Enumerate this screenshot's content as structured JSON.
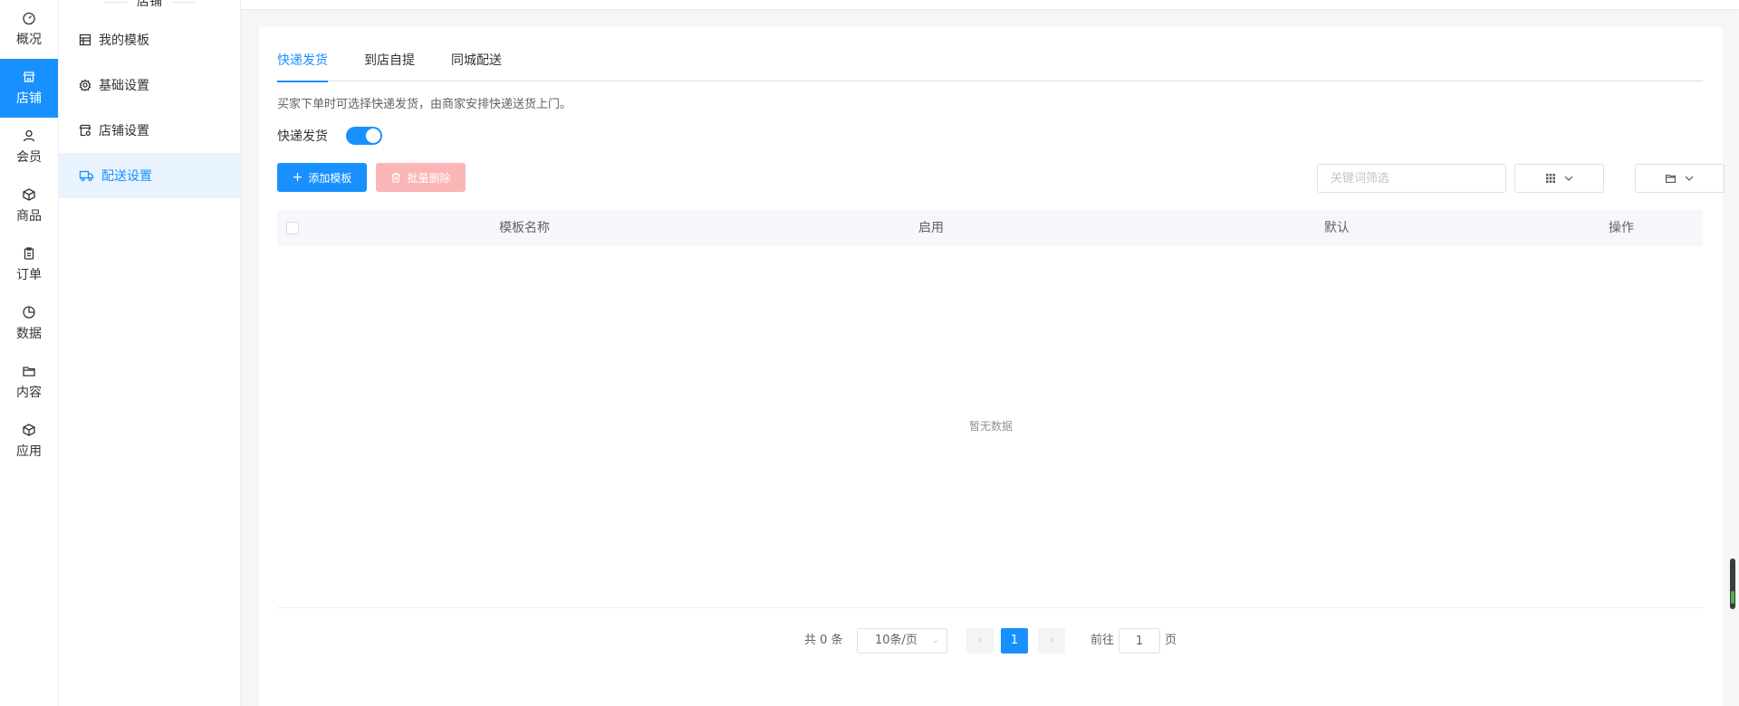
{
  "nav": {
    "items": [
      {
        "label": "概况",
        "icon": "dashboard-icon",
        "active": false
      },
      {
        "label": "店铺",
        "icon": "store-icon",
        "active": true
      },
      {
        "label": "会员",
        "icon": "user-icon",
        "active": false
      },
      {
        "label": "商品",
        "icon": "box-icon",
        "active": false
      },
      {
        "label": "订单",
        "icon": "clipboard-icon",
        "active": false
      },
      {
        "label": "数据",
        "icon": "pie-chart-icon",
        "active": false
      },
      {
        "label": "内容",
        "icon": "folder-icon",
        "active": false
      },
      {
        "label": "应用",
        "icon": "cube-icon",
        "active": false
      }
    ]
  },
  "sidebar": {
    "title": "店铺",
    "items": [
      {
        "label": "我的模板",
        "icon": "template-icon"
      },
      {
        "label": "基础设置",
        "icon": "gear-icon"
      },
      {
        "label": "店铺设置",
        "icon": "store-settings-icon"
      },
      {
        "label": "配送设置",
        "icon": "truck-icon",
        "active": true
      }
    ]
  },
  "tabs": [
    "快递发货",
    "到店自提",
    "同城配送"
  ],
  "description": "买家下单时可选择快递发货，由商家安排快递送货上门。",
  "switch": {
    "label": "快递发货",
    "on": true
  },
  "toolbar": {
    "add_label": "添加模板",
    "delete_label": "批量删除",
    "search_placeholder": "关键词筛选"
  },
  "table": {
    "columns": [
      "模板名称",
      "启用",
      "默认",
      "操作"
    ],
    "empty_text": "暂无数据"
  },
  "pagination": {
    "total": "共 0 条",
    "page_size": "10条/页",
    "current_page": "1",
    "goto_label": "前往",
    "goto_value": "1",
    "page_label": "页"
  },
  "colors": {
    "accent": "#1890ff",
    "danger_disabled": "#fab6b6",
    "sidebar_active_bg": "#e8f3ff"
  }
}
